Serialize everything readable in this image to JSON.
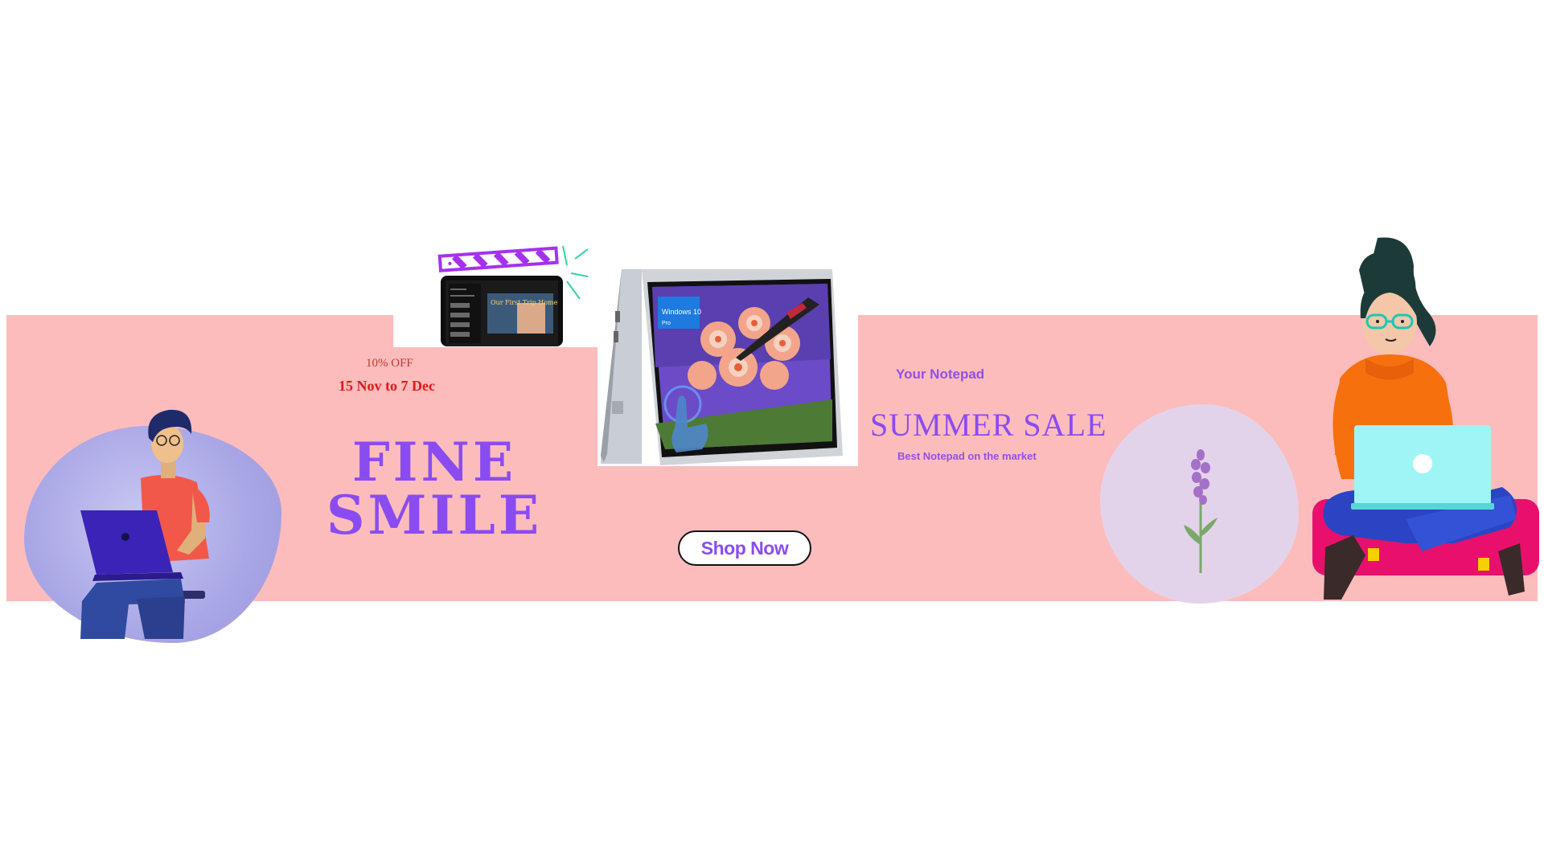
{
  "promo": {
    "discount": "10% OFF",
    "dates": "15 Nov to 7 Dec",
    "brand_line1": "FINE",
    "brand_line2": "SMILE"
  },
  "product": {
    "tagline": "Your Notepad",
    "sale_title": "SUMMER SALE",
    "subtitle": "Best Notepad on the market",
    "tablet_caption": "Our First Trip Home",
    "screen_os": "Windows 10",
    "screen_os_edition": "Pro"
  },
  "cta": {
    "label": "Shop Now"
  },
  "colors": {
    "banner_bg": "#fdbcbc",
    "accent_purple": "#8a4cf0",
    "accent_red": "#e01818"
  },
  "icons": [
    "man-with-laptop-illustration",
    "woman-with-laptop-illustration",
    "lavender-flower-icon",
    "clapperboard-icon",
    "tablet-image",
    "convertible-laptop-image"
  ]
}
